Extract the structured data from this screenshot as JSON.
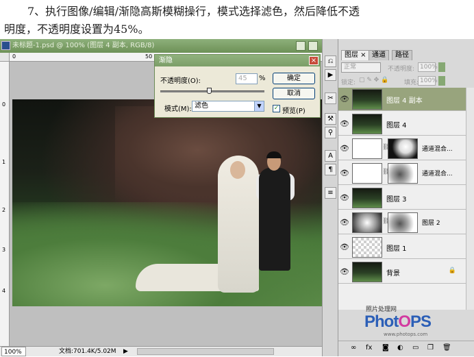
{
  "caption": {
    "line1": "7、执行图像/编辑/渐隐高斯模糊操行，模式选择滤色，然后降低不透",
    "line2": "明度，不透明度设置为45%。"
  },
  "document": {
    "title": "未标题-1.psd @ 100% (图层 4 副本, RGB/8)",
    "ruler_top": [
      "0",
      "50"
    ],
    "ruler_left": [
      "0",
      "1",
      "2",
      "3",
      "4"
    ],
    "zoom": "100%",
    "doc_info": "文档:701.4K/5.02M"
  },
  "fade_dialog": {
    "title": "渐隐",
    "opacity_label": "不透明度(O):",
    "opacity_value": "45",
    "percent": "%",
    "mode_label": "模式(M):",
    "mode_value": "滤色",
    "ok": "确定",
    "cancel": "取消",
    "preview": "预览(P)",
    "preview_checked": true,
    "opacity_fraction": 0.45
  },
  "layers_panel": {
    "tabs": [
      "图层 ×",
      "通道",
      "路径"
    ],
    "blend_mode": "正常",
    "opacity_label": "不透明度:",
    "opacity_value": "100%",
    "lock_label": "锁定:",
    "fill_label": "填充:",
    "fill_value": "100%",
    "layers": [
      {
        "name": "图层 4 副本",
        "thumb": "photo",
        "active": true
      },
      {
        "name": "图层 4",
        "thumb": "photo"
      },
      {
        "name": "通道混合...",
        "thumb": "adj",
        "mask": "mask1"
      },
      {
        "name": "通道混合...",
        "thumb": "adj",
        "mask": "mask2"
      },
      {
        "name": "图层 3",
        "thumb": "photo"
      },
      {
        "name": "图层 2",
        "thumb": "grad",
        "mask": "mask2"
      },
      {
        "name": "图层 1",
        "thumb": "checker"
      },
      {
        "name": "背景",
        "thumb": "photo",
        "locked": true
      }
    ]
  },
  "watermark": {
    "top": "照片处理网",
    "brand_a": "Phot",
    "brand_b": "O",
    "brand_c": "PS",
    "url": "www.photops.com"
  },
  "colors": {
    "title_green": "#7c9e68",
    "active_layer": "#98a47d"
  }
}
